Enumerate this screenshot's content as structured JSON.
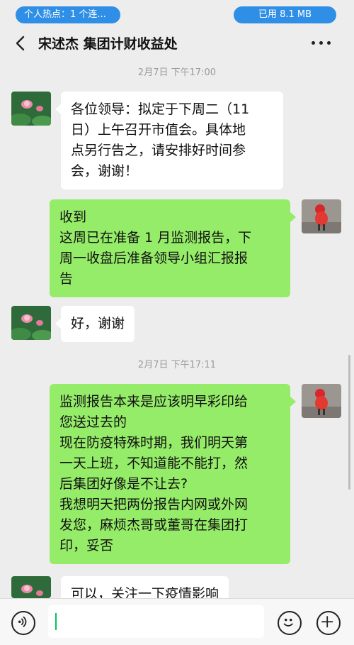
{
  "status_bar": {
    "hotspot_label": "个人热点：1 个连...",
    "data_used_label": "已用 8.1 MB"
  },
  "header": {
    "title": "宋述杰 集团计财收益处",
    "back_icon": "chevron-left-icon",
    "more_icon": "more-dots-icon"
  },
  "timestamps": [
    "2月7日 下午17:00",
    "2月7日 下午17:11"
  ],
  "messages": [
    {
      "side": "in",
      "text": "各位领导：拟定于下周二（11\n日）上午召开市值会。具体地\n点另行告之，请安排好时间参\n会，谢谢！"
    },
    {
      "side": "out",
      "text": "收到\n这周已在准备 1 月监测报告，下\n周一收盘后准备领导小组汇报报\n告"
    },
    {
      "side": "in",
      "text": "好，谢谢"
    },
    {
      "side": "out",
      "text": "监测报告本来是应该明早彩印给\n您送过去的\n现在防疫特殊时期，我们明天第\n一天上班，不知道能不能打，然\n后集团好像是不让去?\n我想明天把两份报告内网或外网\n发您，麻烦杰哥或董哥在集团打\n印，妥否"
    },
    {
      "side": "in",
      "text": "可以，关注一下疫情影响"
    }
  ],
  "input_bar": {
    "voice_icon": "voice-icon",
    "emoji_icon": "emoji-icon",
    "add_icon": "plus-icon",
    "input_value": ""
  },
  "colors": {
    "outgoing_bubble": "#95ec69",
    "incoming_bubble": "#ffffff",
    "background": "#ededed",
    "status_pill": "#2f8fe6"
  }
}
